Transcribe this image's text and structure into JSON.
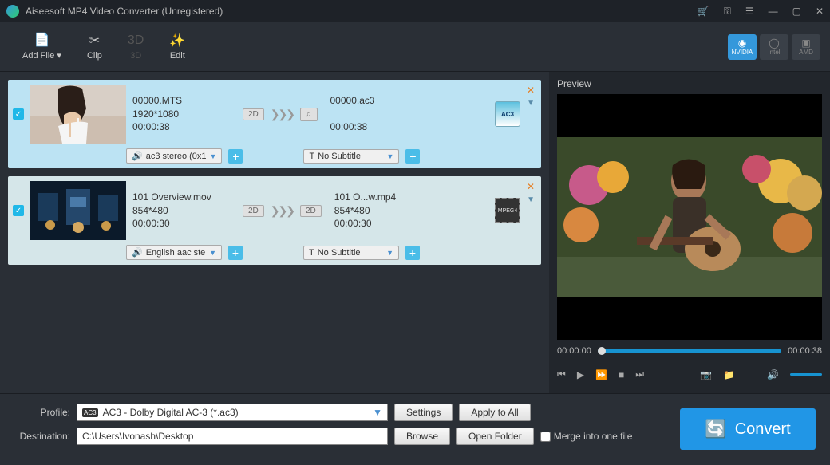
{
  "title": "Aiseesoft MP4 Video Converter (Unregistered)",
  "toolbar": {
    "addFile": "Add File",
    "clip": "Clip",
    "threeD": "3D",
    "edit": "Edit"
  },
  "gpu": {
    "nvidia": "NVIDIA",
    "intel": "Intel",
    "amd": "AMD"
  },
  "files": [
    {
      "srcName": "00000.MTS",
      "srcRes": "1920*1080",
      "srcDur": "00:00:38",
      "srcBadge": "2D",
      "outBadge": "♫",
      "outName": "00000.ac3",
      "outDur": "00:00:38",
      "audio": "ac3 stereo (0x1",
      "subtitle": "No Subtitle",
      "formatIcon": "AC3"
    },
    {
      "srcName": "101 Overview.mov",
      "srcRes": "854*480",
      "srcDur": "00:00:30",
      "srcBadge": "2D",
      "outBadge": "2D",
      "outName": "101 O...w.mp4",
      "outRes": "854*480",
      "outDur": "00:00:30",
      "audio": "English aac ste",
      "subtitle": "No Subtitle",
      "formatIcon": "MPEG4"
    }
  ],
  "preview": {
    "label": "Preview",
    "timeCur": "00:00:00",
    "timeTot": "00:00:38"
  },
  "bottom": {
    "profileLabel": "Profile:",
    "profileValue": "AC3 - Dolby Digital AC-3 (*.ac3)",
    "settings": "Settings",
    "applyAll": "Apply to All",
    "destLabel": "Destination:",
    "destValue": "C:\\Users\\Ivonash\\Desktop",
    "browse": "Browse",
    "openFolder": "Open Folder",
    "merge": "Merge into one file",
    "convert": "Convert"
  }
}
